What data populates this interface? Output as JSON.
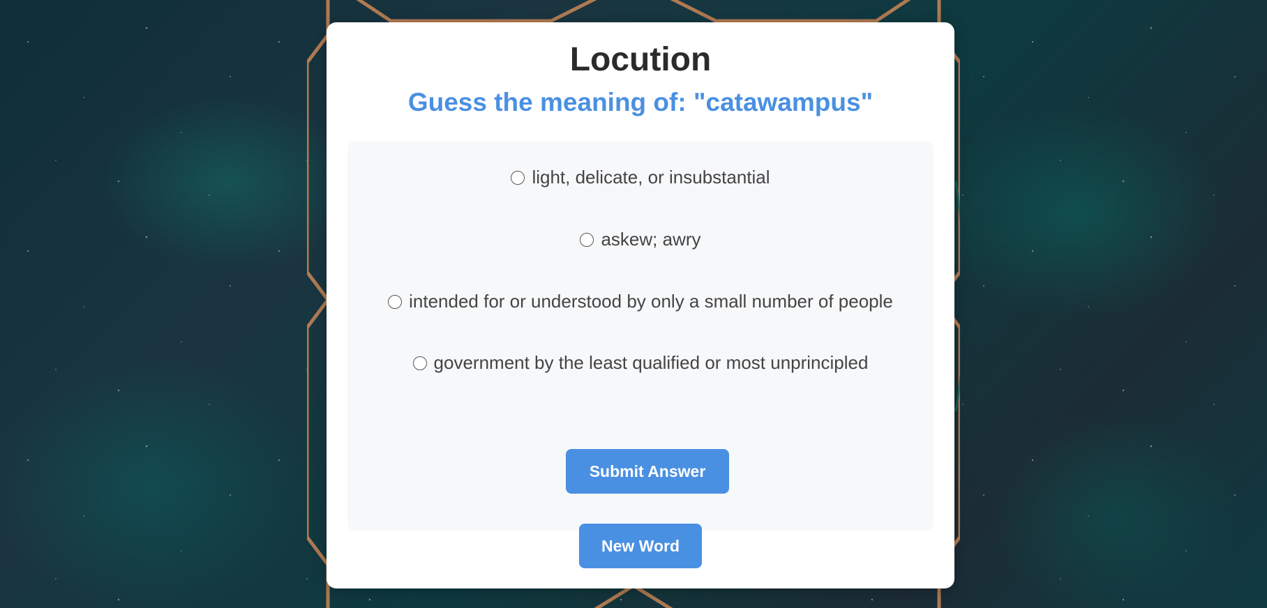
{
  "app": {
    "title": "Locution",
    "prompt": "Guess the meaning of: \"catawampus\""
  },
  "quiz": {
    "options": [
      {
        "label": "light, delicate, or insubstantial",
        "selected": false
      },
      {
        "label": "askew; awry",
        "selected": false
      },
      {
        "label": "intended for or understood by only a small number of people",
        "selected": false
      },
      {
        "label": "government by the least qualified or most unprincipled",
        "selected": false
      }
    ],
    "submit_label": "Submit Answer"
  },
  "actions": {
    "new_word_label": "New Word"
  },
  "colors": {
    "accent": "#4a90e2",
    "title": "#2b2b2b",
    "panel": "#f7f8fa",
    "frame": "#b07a52"
  }
}
